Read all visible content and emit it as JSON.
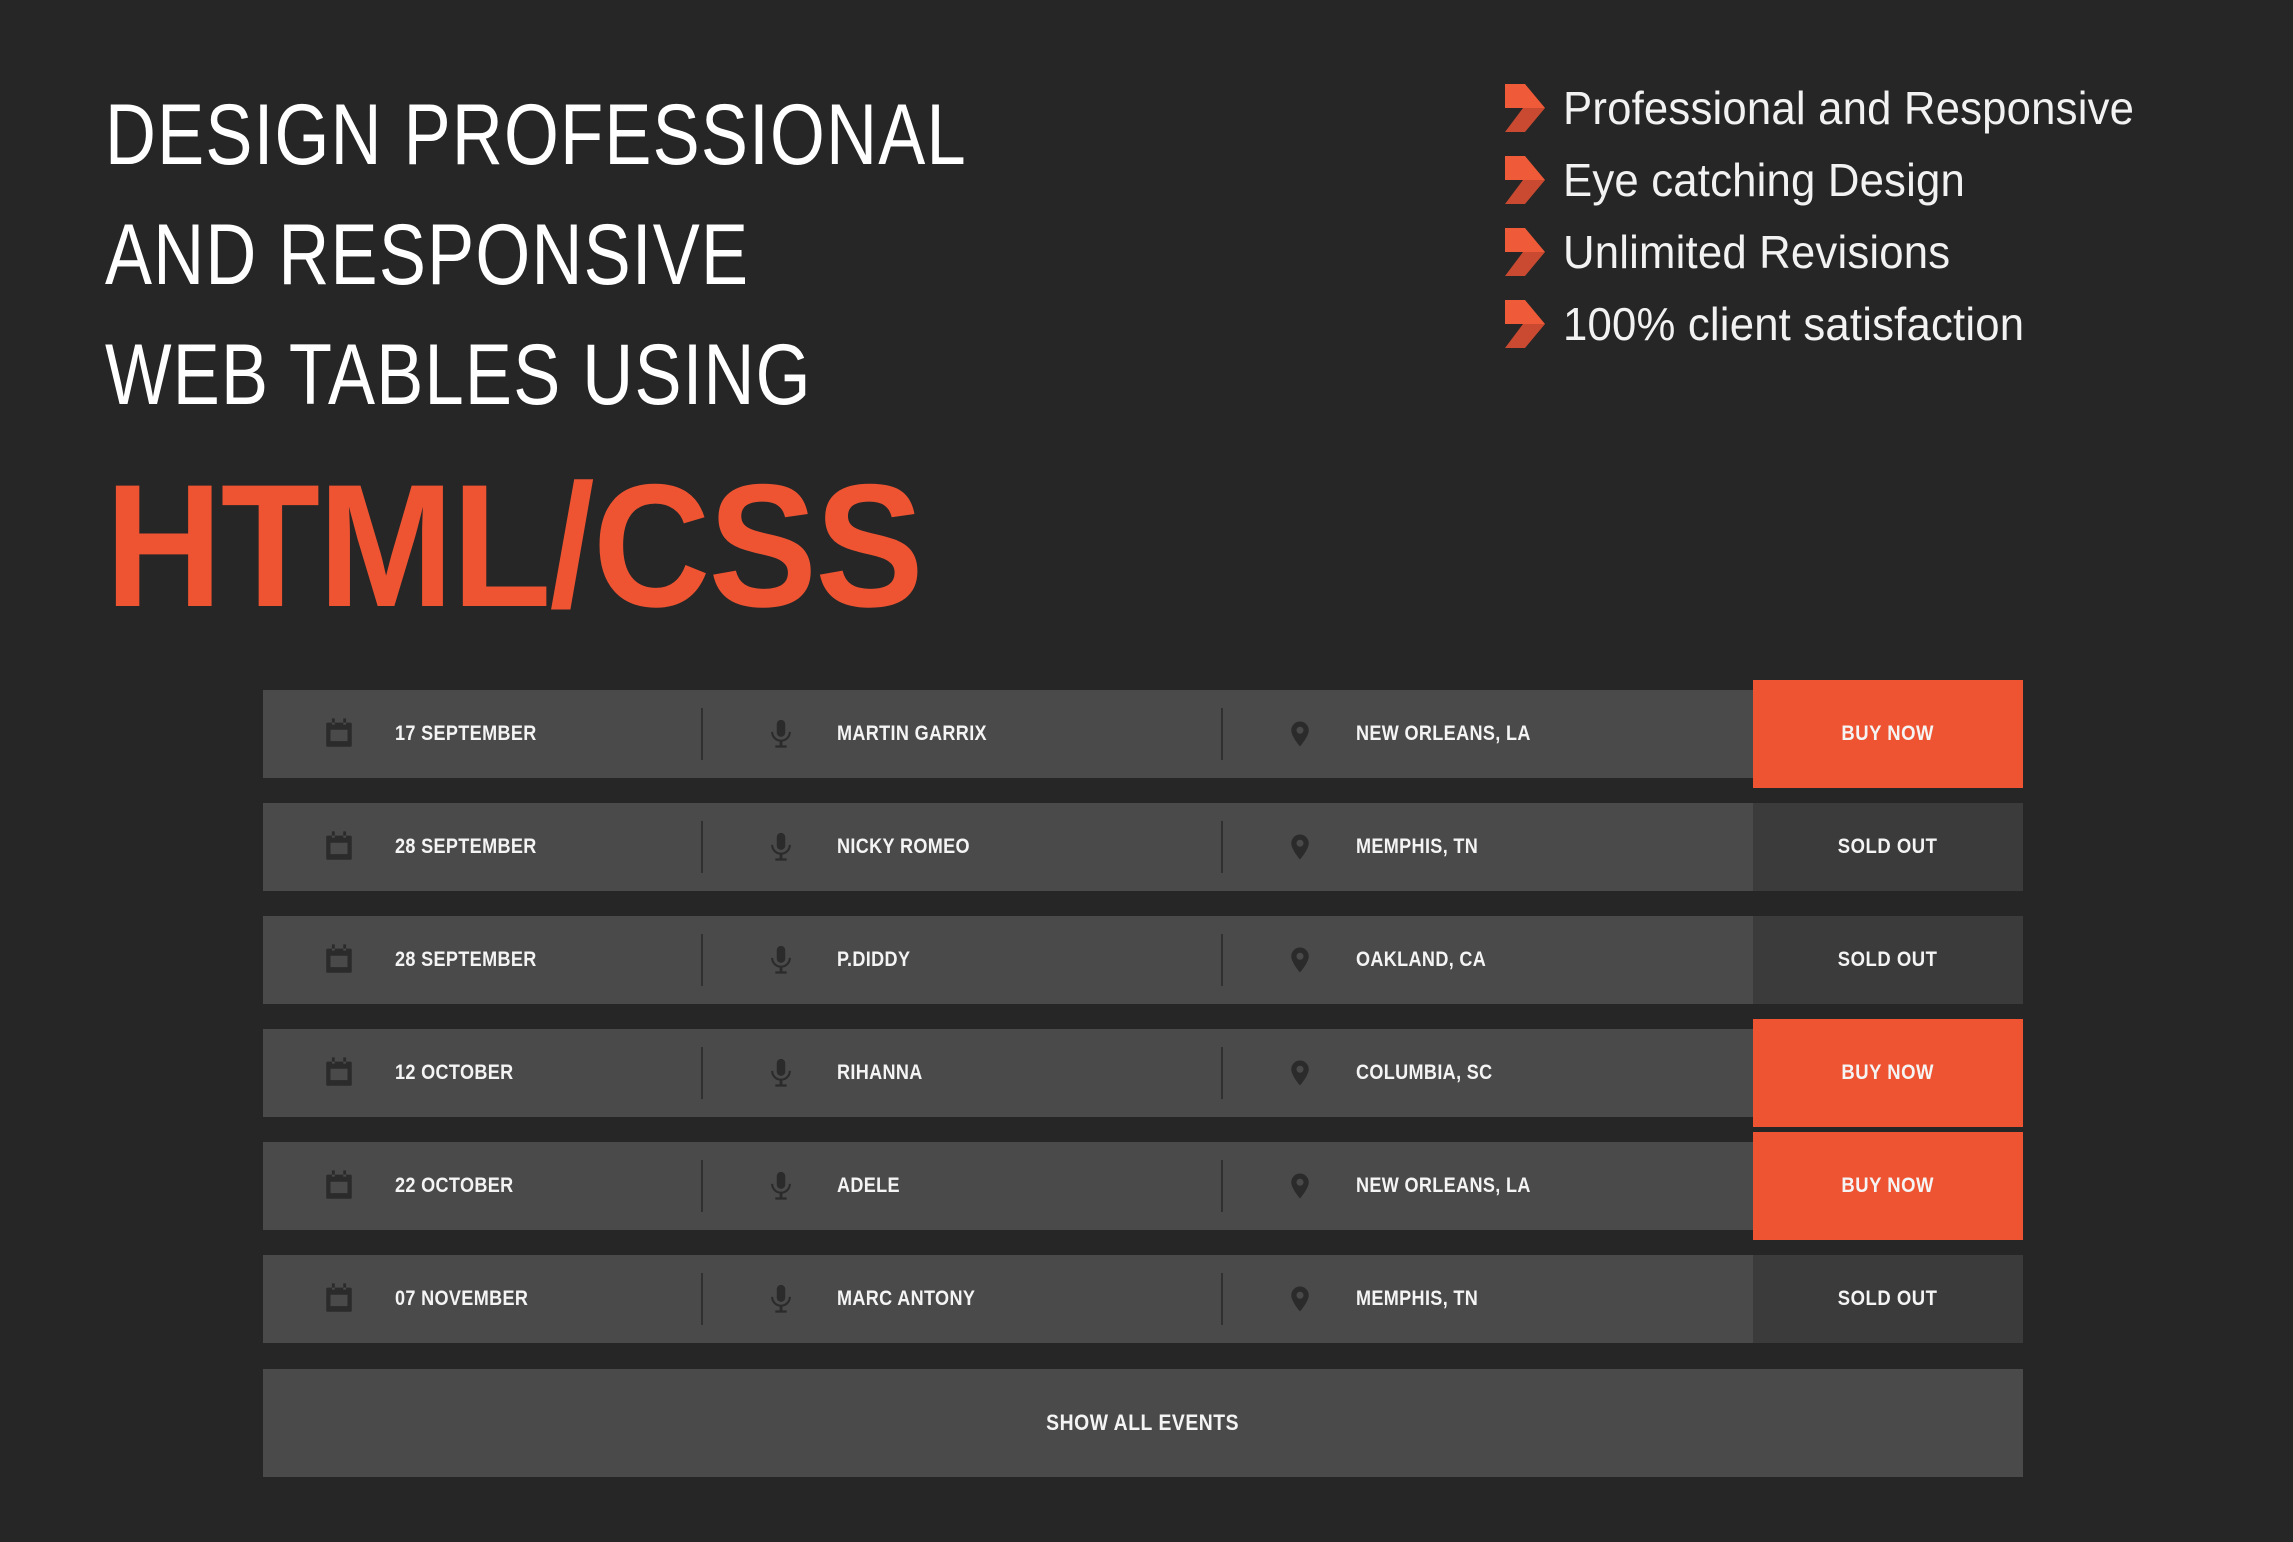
{
  "hero": {
    "headline_lines": [
      "DESIGN PROFESSIONAL",
      "AND RESPONSIVE",
      "WEB TABLES USING"
    ],
    "headline_accent": "HTML/CSS",
    "accent_color": "#ee5432",
    "background_color": "#262626"
  },
  "bullets": {
    "items": [
      {
        "icon": "chevron-right-icon",
        "label": "Professional and Responsive"
      },
      {
        "icon": "chevron-right-icon",
        "label": "Eye catching Design"
      },
      {
        "icon": "chevron-right-icon",
        "label": "Unlimited Revisions"
      },
      {
        "icon": "chevron-right-icon",
        "label": "100% client satisfaction"
      }
    ]
  },
  "event_table": {
    "row_background": "#4a4a4a",
    "buy_button_color": "#ee5432",
    "sold_out_background": "#3b3b3b",
    "icons": {
      "date": "calendar-icon",
      "artist": "microphone-icon",
      "venue": "map-pin-icon"
    },
    "rows": [
      {
        "date": "17 SEPTEMBER",
        "artist": "MARTIN GARRIX",
        "venue": "NEW ORLEANS, LA",
        "action": "BUY NOW",
        "state": "buy"
      },
      {
        "date": "28 SEPTEMBER",
        "artist": "NICKY ROMEO",
        "venue": "MEMPHIS, TN",
        "action": "SOLD OUT",
        "state": "sold"
      },
      {
        "date": "28 SEPTEMBER",
        "artist": "P.DIDDY",
        "venue": "OAKLAND, CA",
        "action": "SOLD OUT",
        "state": "sold"
      },
      {
        "date": "12 OCTOBER",
        "artist": "RIHANNA",
        "venue": "COLUMBIA, SC",
        "action": "BUY NOW",
        "state": "buy"
      },
      {
        "date": "22 OCTOBER",
        "artist": "ADELE",
        "venue": "NEW ORLEANS, LA",
        "action": "BUY NOW",
        "state": "buy"
      },
      {
        "date": "07 NOVEMBER",
        "artist": "MARC ANTONY",
        "venue": "MEMPHIS, TN",
        "action": "SOLD OUT",
        "state": "sold"
      }
    ],
    "show_all_label": "SHOW ALL EVENTS"
  }
}
